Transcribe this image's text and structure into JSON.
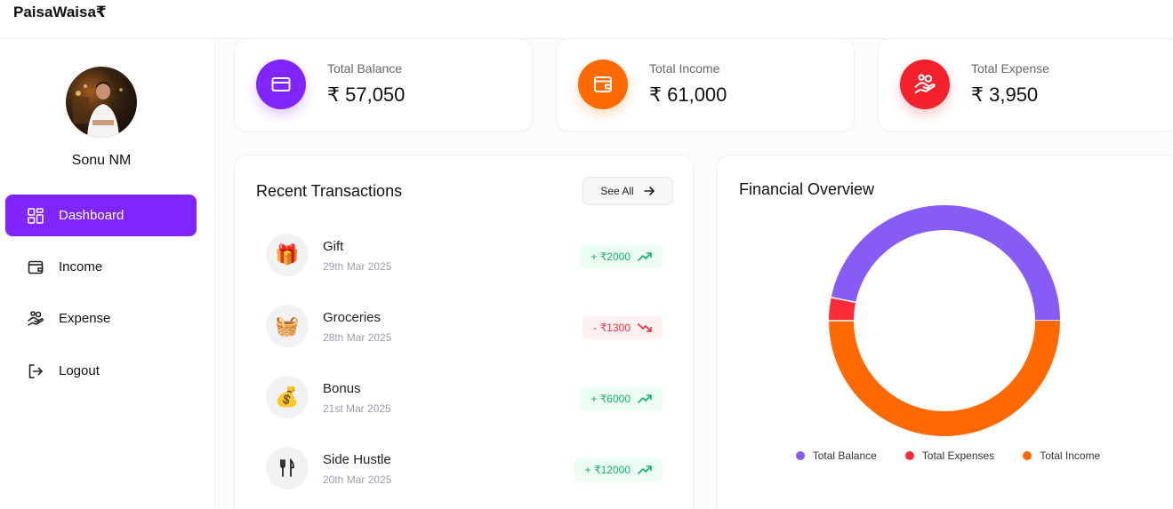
{
  "app": {
    "brand": "PaisaWaisa₹"
  },
  "user": {
    "name": "Sonu NM"
  },
  "sidebar": {
    "items": [
      {
        "label": "Dashboard",
        "icon": "dashboard-icon",
        "active": true
      },
      {
        "label": "Income",
        "icon": "wallet-icon",
        "active": false
      },
      {
        "label": "Expense",
        "icon": "hand-coins-icon",
        "active": false
      },
      {
        "label": "Logout",
        "icon": "logout-icon",
        "active": false
      }
    ]
  },
  "stats": [
    {
      "label": "Total Balance",
      "value": "₹ 57,050",
      "icon": "credit-card-icon",
      "color": "#8125ff"
    },
    {
      "label": "Total Income",
      "value": "₹ 61,000",
      "icon": "wallet-icon",
      "color": "#ff6a00"
    },
    {
      "label": "Total Expense",
      "value": "₹ 3,950",
      "icon": "hand-coins-icon",
      "color": "#f5222d"
    }
  ],
  "recent": {
    "title": "Recent Transactions",
    "see_all": "See All",
    "items": [
      {
        "name": "Gift",
        "date": "29th Mar 2025",
        "amount": "+ ₹2000",
        "type": "income",
        "icon": "gift-icon"
      },
      {
        "name": "Groceries",
        "date": "28th Mar 2025",
        "amount": "- ₹1300",
        "type": "expense",
        "icon": "basket-icon"
      },
      {
        "name": "Bonus",
        "date": "21st Mar 2025",
        "amount": "+ ₹6000",
        "type": "income",
        "icon": "money-bag-icon"
      },
      {
        "name": "Side Hustle",
        "date": "20th Mar 2025",
        "amount": "+ ₹12000",
        "type": "income",
        "icon": "utensils-icon"
      }
    ]
  },
  "overview": {
    "title": "Financial Overview",
    "legend": [
      {
        "label": "Total Balance",
        "color": "#875cf5"
      },
      {
        "label": "Total Expenses",
        "color": "#fa2c37"
      },
      {
        "label": "Total Income",
        "color": "#ff6900"
      }
    ]
  },
  "chart_data": {
    "type": "pie",
    "title": "Financial Overview",
    "labels": [
      "Total Balance",
      "Total Expenses",
      "Total Income"
    ],
    "values": [
      57050,
      3950,
      61000
    ],
    "colors": [
      "#875cf5",
      "#fa2c37",
      "#ff6900"
    ],
    "legend": "bottom"
  }
}
